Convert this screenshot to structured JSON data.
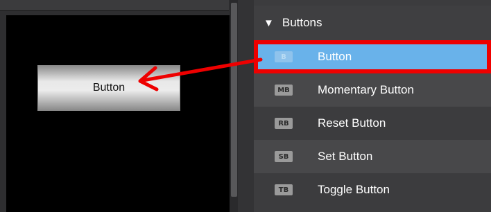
{
  "canvas": {
    "button_label": "Button"
  },
  "toolbox": {
    "section_title": "Buttons",
    "section_expanded_glyph": "▼",
    "items": [
      {
        "badge": "B",
        "label": "Button",
        "selected": true
      },
      {
        "badge": "MB",
        "label": "Momentary Button",
        "selected": false
      },
      {
        "badge": "RB",
        "label": "Reset Button",
        "selected": false
      },
      {
        "badge": "SB",
        "label": "Set Button",
        "selected": false
      },
      {
        "badge": "TB",
        "label": "Toggle Button",
        "selected": false
      }
    ]
  },
  "colors": {
    "highlight_border": "#ee0000",
    "selected_bg": "#69b2ea",
    "annotation_arrow": "#ee0000"
  },
  "annotation": {
    "arrow_icon": "arrow-left-icon"
  }
}
